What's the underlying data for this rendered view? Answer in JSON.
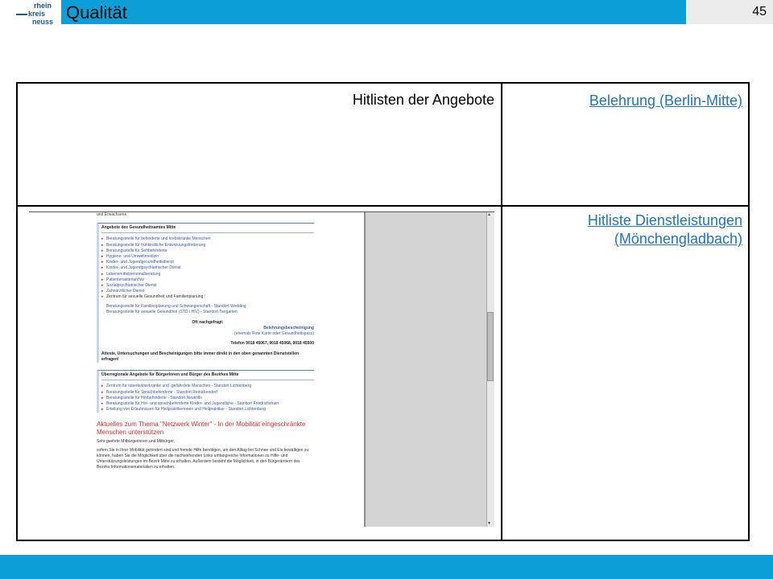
{
  "header": {
    "logo": {
      "line1": "rhein",
      "line2": "kreis",
      "line3": "neuss"
    },
    "title": "Qualität",
    "page_number": "45"
  },
  "table": {
    "row1": {
      "label": "Hitlisten der Angebote",
      "link": "Belehrung (Berlin-Mitte)"
    },
    "row2": {
      "link_line1": "Hitliste Dienstleistungen",
      "link_line2": "(Mönchengladbach)"
    }
  },
  "screenshot": {
    "top_text": "und Erwachsene",
    "box1": {
      "title": "Angebote des Gesundheitsamtes Mitte",
      "items": [
        "Beratungsstelle für behinderte und krebskranke Menschen",
        "Beratungsstelle für frühkindliche Entwicklungsförderung",
        "Beratungsstelle für Sehbehinderte",
        "Hygiene- und Umweltmedizin",
        "Kinder- und Jugendgesundheitsdienst",
        "Kinder- und Jugendpsychiatrischer Dienst",
        "Lebensmittelpersonalberatung",
        "Patientenaktenarchiv",
        "Sozialpsychiatrischer Dienst",
        "Zahnärztlicher Dienst",
        "Zentrum für sexuelle Gesundheit und Familienplanung :"
      ],
      "sub_items": [
        "Beratungsstelle für Familienplanung und Schwangerschaft - Standort Wedding",
        "Beratungsstelle für sexuelle Gesundheit (STD / HIV) - Standort Tiergarten"
      ],
      "oft": "Oft nachgefragt:",
      "right1": "Belehrungsbescheinigung",
      "right2": "(ehemals Rote Karte oder Gesundheitspass)",
      "tel": "Telefon 9018 45067, 9018 45068, 9018 45500",
      "bold_note": "Atteste, Untersuchungen und Bescheinigungen bitte immer direkt in den oben genannten Dienststellen erfragen!"
    },
    "box2": {
      "title": "Überregionale Angebote für Bürgerinnen und Bürger des Bezirkes Mitte",
      "items": [
        "Zentrum für tuberkulosekranke und -gefährdete Menschen - Standort Lichtenberg",
        "Beratungsstelle für Sprachbehinderte - Standort Reinickendorf",
        "Beratungsstelle für Hörbehinderte - Standort Neukölln",
        "Beratungsstelle für Hör- und sprachbehinderte Kinder- und Jugendliche - Standort Friedrichshain",
        "Erteilung von Erlaubnissen für Heilpraktikerinnen und Heilpraktiker - Standort Lichtenberg"
      ]
    },
    "news_title": "Aktuelles zum Thema \"Netzwerk Winter\" - In der Mobilität eingeschränkte Menschen unterstützen",
    "greeting": "Sehr geehrte Mitbürgerinnen und Mitbürger,",
    "body": "sofern Sie in Ihrer Mobilität gehindert sind und fremde Hilfe benötigen, um den Alltag bei Schnee und Eis bewältigen zu können, haben Sie die Möglichkeit über die nachstehenden Links umfangreiche Informationen zu Hilfe- und Unterstützungsleistungen im Bezirk Mitte zu erhalten. Außerdem besteht die Möglichkeit, in den Bürgerämtern des Bezirks Informationsmaterialien zu erhalten."
  },
  "colors": {
    "accent": "#0c9ed6",
    "link": "#2275b8",
    "page_box": "#ececec"
  }
}
